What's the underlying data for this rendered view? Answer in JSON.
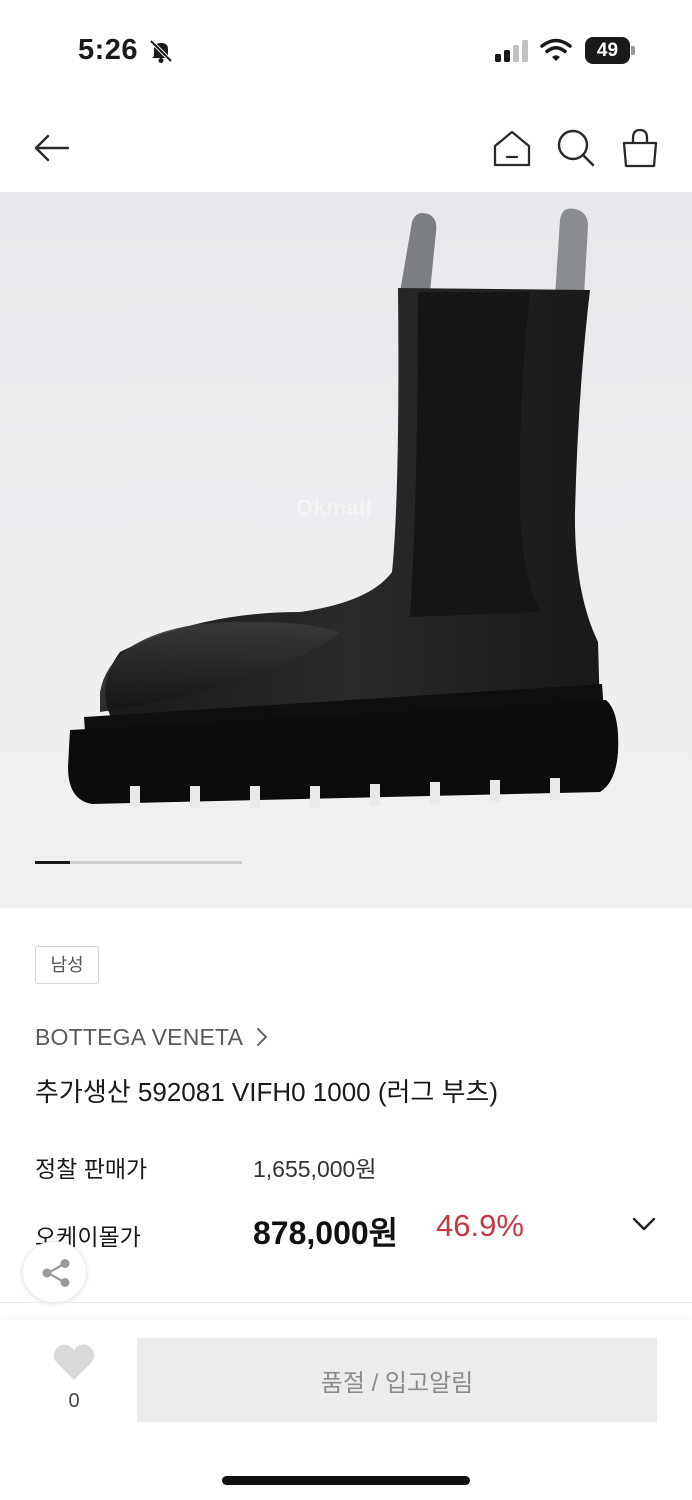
{
  "status_bar": {
    "time": "5:26",
    "battery": "49"
  },
  "nav": {
    "icons": [
      "back-arrow-icon",
      "home-icon",
      "search-icon",
      "shopping-bag-icon"
    ]
  },
  "gallery": {
    "watermark": "Okmall",
    "current_index": 1,
    "progress": 0.17
  },
  "product": {
    "gender_badge": "남성",
    "brand": "BOTTEGA VENETA",
    "title": "추가생산 592081 VIFH0 1000 (러그 부츠)"
  },
  "price": {
    "retail_label": "정찰 판매가",
    "retail_value": "1,655,000원",
    "ok_label": "오케이몰가",
    "ok_value": "878,000원",
    "discount": "46.9%"
  },
  "bottom_bar": {
    "wish_count": "0",
    "cta_label": "품절 / 입고알림"
  },
  "colors": {
    "discount": "#c4393f",
    "cta_background": "#ececec",
    "cta_text": "#8c8c8c"
  }
}
